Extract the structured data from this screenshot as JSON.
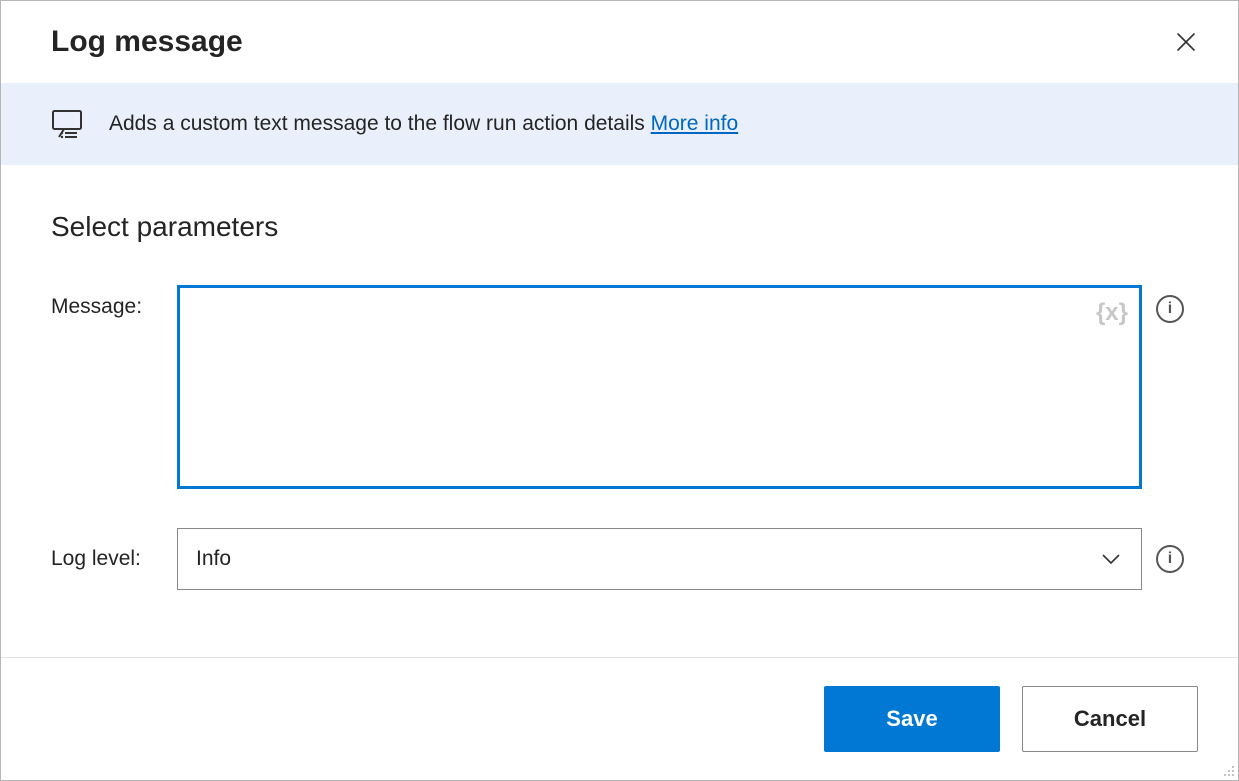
{
  "header": {
    "title": "Log message"
  },
  "banner": {
    "description": "Adds a custom text message to the flow run action details ",
    "link_text": "More info"
  },
  "section": {
    "title": "Select parameters"
  },
  "params": {
    "message": {
      "label": "Message:",
      "value": "",
      "variable_token": "{x}"
    },
    "log_level": {
      "label": "Log level:",
      "value": "Info"
    }
  },
  "footer": {
    "save": "Save",
    "cancel": "Cancel"
  }
}
